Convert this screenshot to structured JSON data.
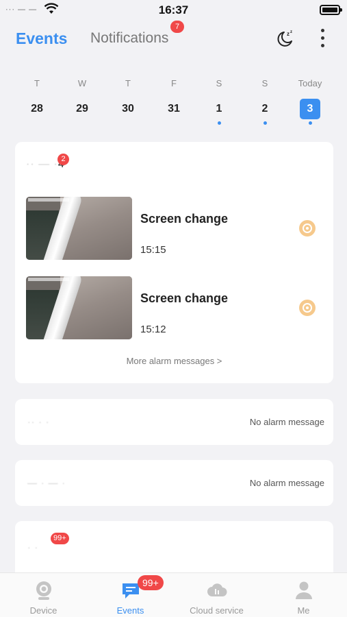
{
  "status_bar": {
    "carrier": "··· — —",
    "time": "16:37"
  },
  "header": {
    "tab_events": "Events",
    "tab_notifications": "Notifications",
    "notifications_badge": "7",
    "moon_icon": "moon-sleep-icon",
    "more_icon": "more-vertical-icon"
  },
  "date_strip": {
    "days": [
      {
        "letter": "T",
        "num": "28",
        "dot": false,
        "active": false
      },
      {
        "letter": "W",
        "num": "29",
        "dot": false,
        "active": false
      },
      {
        "letter": "T",
        "num": "30",
        "dot": false,
        "active": false
      },
      {
        "letter": "F",
        "num": "31",
        "dot": false,
        "active": false
      },
      {
        "letter": "S",
        "num": "1",
        "dot": true,
        "active": false
      },
      {
        "letter": "S",
        "num": "2",
        "dot": true,
        "active": false
      },
      {
        "letter": "Today",
        "num": "3",
        "dot": true,
        "active": true
      }
    ]
  },
  "device_card": {
    "name_blurred": "·· — ·",
    "name_suffix": "4",
    "badge": "2",
    "alarms": [
      {
        "title": "Screen change",
        "time": "15:15"
      },
      {
        "title": "Screen change",
        "time": "15:12"
      }
    ],
    "more_link": "More alarm messages >"
  },
  "device_rows": [
    {
      "name": "·· · ·",
      "status": "No alarm message"
    },
    {
      "name": "— · — ·",
      "status": "No alarm message"
    }
  ],
  "last_card": {
    "name": "· ·",
    "badge": "99+"
  },
  "tab_bar": {
    "device": "Device",
    "events": "Events",
    "events_badge": "99+",
    "cloud": "Cloud service",
    "me": "Me"
  },
  "colors": {
    "accent": "#3b8ff0",
    "badge": "#f04848",
    "alarm_icon": "#f6c98c",
    "background": "#f2f2f5"
  }
}
